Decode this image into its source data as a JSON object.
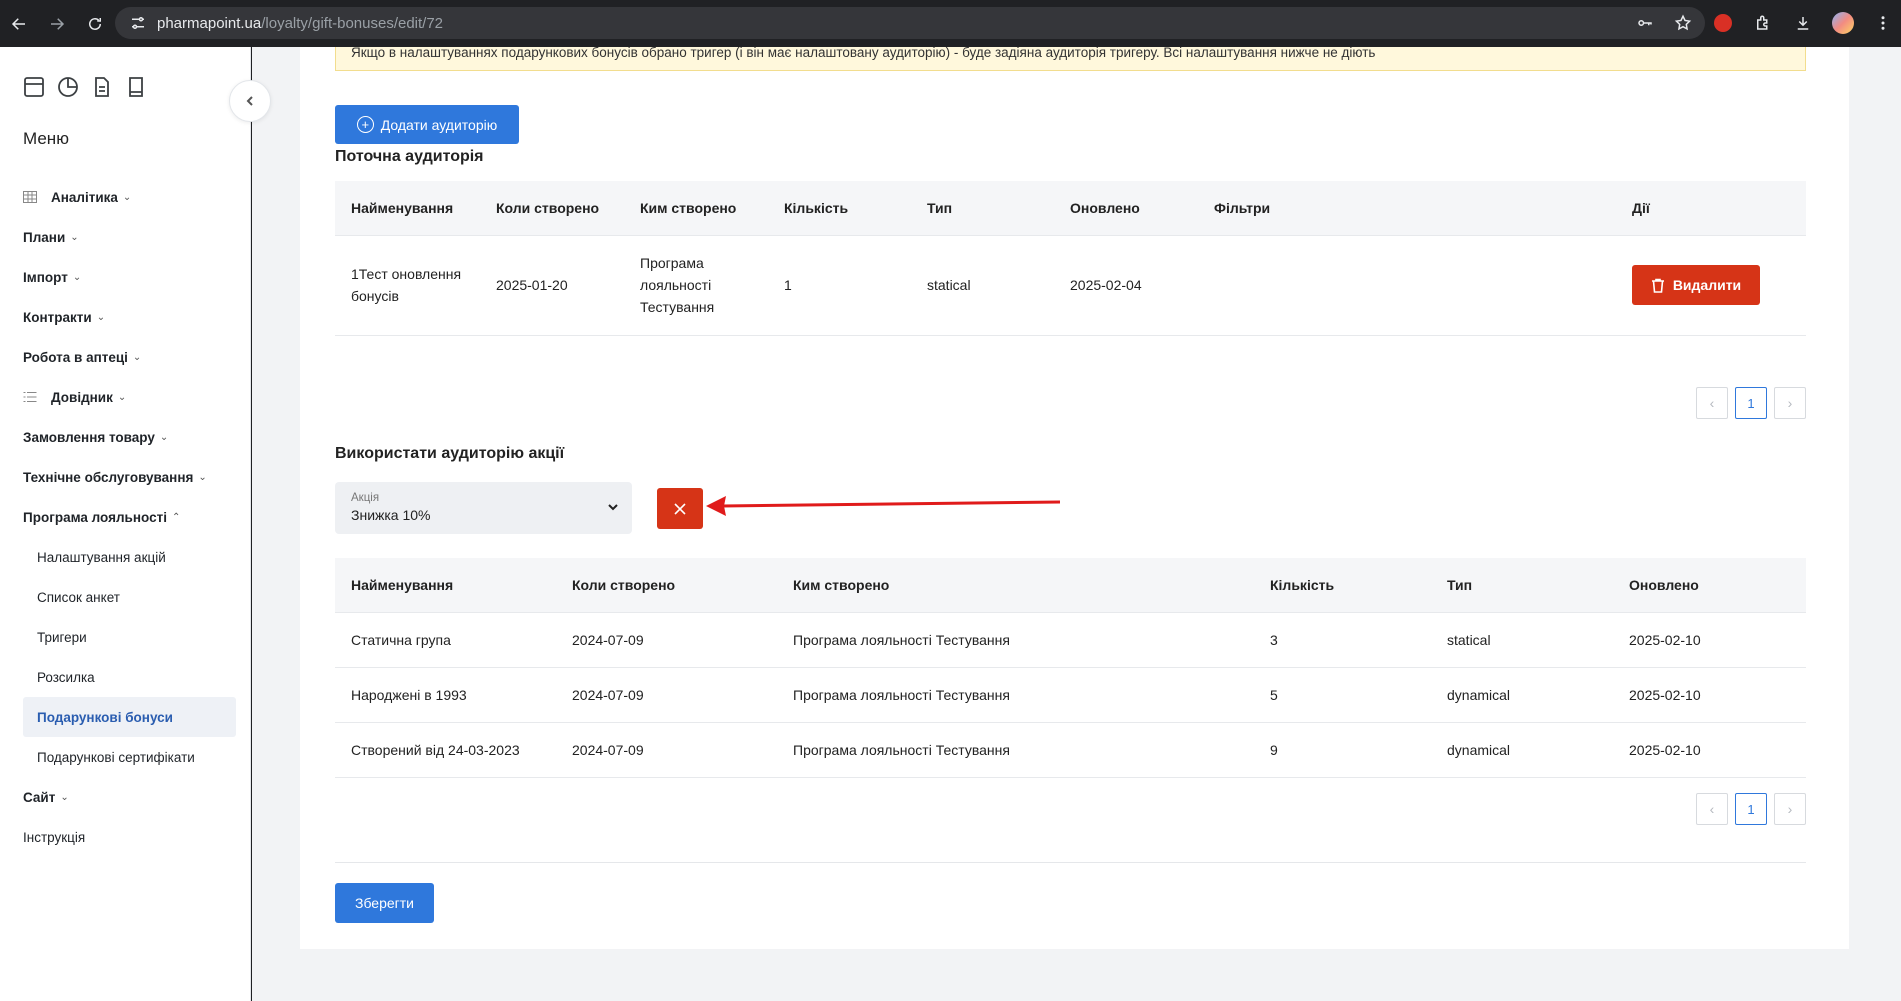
{
  "browser": {
    "url_host": "pharmapoint.ua",
    "url_path": "/loyalty/gift-bonuses/edit/72"
  },
  "sidebar": {
    "menu_title": "Меню",
    "items": [
      {
        "label": "Аналітика"
      },
      {
        "label": "Плани"
      },
      {
        "label": "Імпорт"
      },
      {
        "label": "Контракти"
      },
      {
        "label": "Робота в аптеці"
      },
      {
        "label": "Довідник"
      },
      {
        "label": "Замовлення товару"
      },
      {
        "label": "Технічне обслуговування"
      },
      {
        "label": "Програма лояльності"
      }
    ],
    "sub_items": [
      {
        "label": "Налаштування акцій"
      },
      {
        "label": "Список анкет"
      },
      {
        "label": "Тригери"
      },
      {
        "label": "Розсилка"
      },
      {
        "label": "Подарункові бонуси"
      },
      {
        "label": "Подарункові сертифікати"
      }
    ],
    "after_items": [
      {
        "label": "Сайт"
      }
    ],
    "instruction": "Інструкція"
  },
  "main": {
    "alert": "Якщо в налаштуваннях подарункових бонусів обрано тригер (і він має налаштовану аудиторію) - буде задіяна аудиторія тригеру. Всі налаштування нижче не діють",
    "add_audience_label": "Додати аудиторію",
    "current_title": "Поточна аудиторія",
    "current_table": {
      "headers": [
        "Найменування",
        "Коли створено",
        "Ким створено",
        "Кількість",
        "Тип",
        "Оновлено",
        "Фільтри",
        "Дії"
      ],
      "row": {
        "name": "1Тест оновлення бонусів",
        "created": "2025-01-20",
        "creator": "Програма лояльності Тестування",
        "count": "1",
        "type": "statical",
        "updated": "2025-02-04",
        "filters": "",
        "delete_label": "Видалити"
      }
    },
    "pager_page": "1",
    "use_title": "Використати аудиторію акції",
    "promo_select": {
      "label": "Акція",
      "value": "Знижка 10%"
    },
    "promo_table": {
      "headers": [
        "Найменування",
        "Коли створено",
        "Ким створено",
        "Кількість",
        "Тип",
        "Оновлено"
      ],
      "rows": [
        {
          "name": "Статична група",
          "created": "2024-07-09",
          "creator": "Програма лояльності Тестування",
          "count": "3",
          "type": "statical",
          "updated": "2025-02-10"
        },
        {
          "name": "Народжені в 1993",
          "created": "2024-07-09",
          "creator": "Програма лояльності Тестування",
          "count": "5",
          "type": "dynamical",
          "updated": "2025-02-10"
        },
        {
          "name": "Створений від 24-03-2023",
          "created": "2024-07-09",
          "creator": "Програма лояльності Тестування",
          "count": "9",
          "type": "dynamical",
          "updated": "2025-02-10"
        }
      ]
    },
    "save_label": "Зберегти"
  },
  "colors": {
    "primary": "#2f78dc",
    "danger": "#d63417",
    "arrow": "#e01b1b"
  }
}
